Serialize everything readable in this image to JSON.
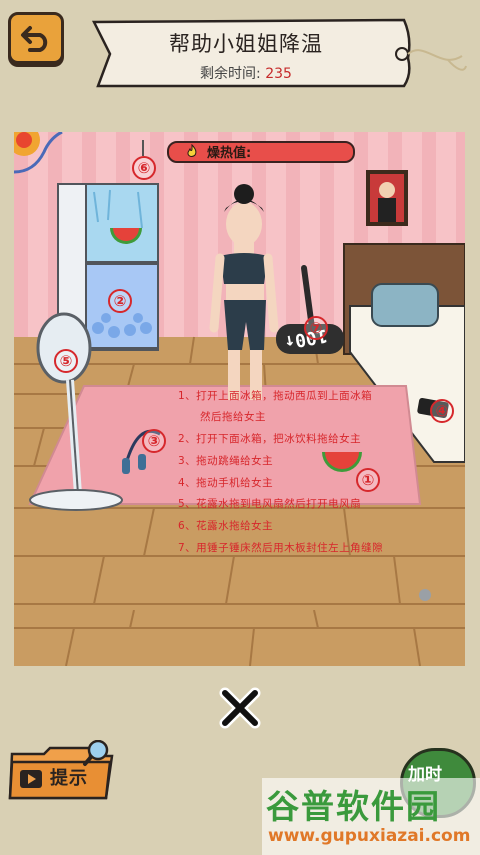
{
  "header": {
    "title": "帮助小姐姐降温",
    "timer_label": "剩余时间:",
    "timer_value": "235"
  },
  "scene": {
    "heat_label": "燥热值:",
    "markers": [
      "①",
      "②",
      "③",
      "④",
      "⑤",
      "⑥",
      "⑦"
    ],
    "digital_display": "100↑",
    "hints": [
      "1、打开上面冰箱，拖动西瓜到上面冰箱",
      "然后拖给女主",
      "2、打开下面冰箱，把冰饮料拖给女主",
      "3、拖动跳绳给女主",
      "4、拖动手机给女主",
      "5、花露水拖到电风扇然后打开电风扇",
      "6、花露水拖给女主",
      "7、用锤子锤床然后用木板封住左上角缝隙"
    ]
  },
  "footer": {
    "hint_button": "提示",
    "add_time_button": "加时"
  },
  "watermark": {
    "title": "谷普软件园",
    "url": "www.gupuxiazai.com"
  },
  "colors": {
    "background": "#d9d0b4",
    "wall": "#f7c3c7",
    "floor": "#c99c62",
    "hint_text": "#d7262b",
    "watermark_green": "#3a9a3c",
    "watermark_orange": "#e07828"
  }
}
